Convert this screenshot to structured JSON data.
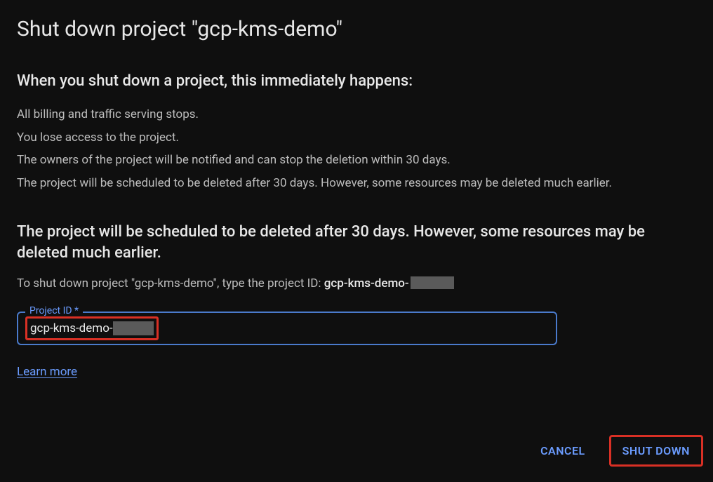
{
  "dialog": {
    "title": "Shut down project \"gcp-kms-demo\"",
    "section1_heading": "When you shut down a project, this immediately happens:",
    "bullets": [
      "All billing and traffic serving stops.",
      "You lose access to the project.",
      "The owners of the project will be notified and can stop the deletion within 30 days.",
      "The project will be scheduled to be deleted after 30 days. However, some resources may be deleted much earlier."
    ],
    "section2_heading": "The project will be scheduled to be deleted after 30 days. However, some resources may be deleted much earlier.",
    "confirm_prefix": "To shut down project \"gcp-kms-demo\", type the project ID: ",
    "confirm_project_id_prefix": "gcp-kms-demo-",
    "input": {
      "label": "Project ID *",
      "value_prefix": "gcp-kms-demo-"
    },
    "learn_more": "Learn more",
    "buttons": {
      "cancel": "CANCEL",
      "shutdown": "SHUT DOWN"
    }
  }
}
